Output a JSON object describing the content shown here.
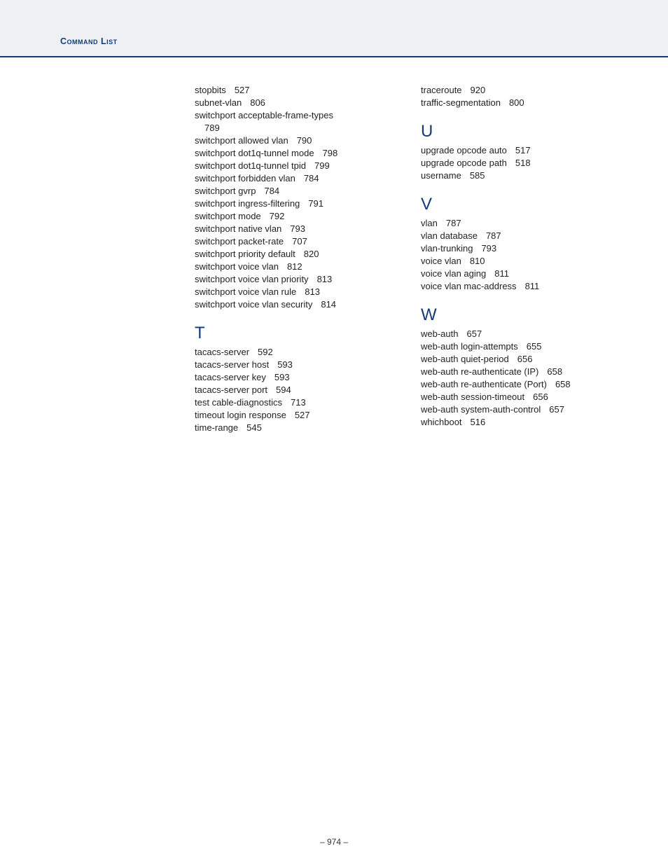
{
  "header": {
    "title": "Command List"
  },
  "footer": {
    "page": "– 974 –"
  },
  "col1_pre_entries": [
    {
      "cmd": "stopbits",
      "pg": "527"
    },
    {
      "cmd": "subnet-vlan",
      "pg": "806"
    },
    {
      "cmd": "switchport acceptable-frame-types",
      "pg": "789",
      "wrap": true
    },
    {
      "cmd": "switchport allowed vlan",
      "pg": "790"
    },
    {
      "cmd": "switchport dot1q-tunnel mode",
      "pg": "798"
    },
    {
      "cmd": "switchport dot1q-tunnel tpid",
      "pg": "799"
    },
    {
      "cmd": "switchport forbidden vlan",
      "pg": "784"
    },
    {
      "cmd": "switchport gvrp",
      "pg": "784"
    },
    {
      "cmd": "switchport ingress-filtering",
      "pg": "791"
    },
    {
      "cmd": "switchport mode",
      "pg": "792"
    },
    {
      "cmd": "switchport native vlan",
      "pg": "793"
    },
    {
      "cmd": "switchport packet-rate",
      "pg": "707"
    },
    {
      "cmd": "switchport priority default",
      "pg": "820"
    },
    {
      "cmd": "switchport voice vlan",
      "pg": "812"
    },
    {
      "cmd": "switchport voice vlan priority",
      "pg": "813"
    },
    {
      "cmd": "switchport voice vlan rule",
      "pg": "813"
    },
    {
      "cmd": "switchport voice vlan security",
      "pg": "814"
    }
  ],
  "col1_sections": [
    {
      "letter": "T",
      "entries": [
        {
          "cmd": "tacacs-server",
          "pg": "592"
        },
        {
          "cmd": "tacacs-server host",
          "pg": "593"
        },
        {
          "cmd": "tacacs-server key",
          "pg": "593"
        },
        {
          "cmd": "tacacs-server port",
          "pg": "594"
        },
        {
          "cmd": "test cable-diagnostics",
          "pg": "713"
        },
        {
          "cmd": "timeout login response",
          "pg": "527"
        },
        {
          "cmd": "time-range",
          "pg": "545"
        }
      ]
    }
  ],
  "col2_pre_entries": [
    {
      "cmd": "traceroute",
      "pg": "920"
    },
    {
      "cmd": "traffic-segmentation",
      "pg": "800"
    }
  ],
  "col2_sections": [
    {
      "letter": "U",
      "entries": [
        {
          "cmd": "upgrade opcode auto",
          "pg": "517"
        },
        {
          "cmd": "upgrade opcode path",
          "pg": "518"
        },
        {
          "cmd": "username",
          "pg": "585"
        }
      ]
    },
    {
      "letter": "V",
      "entries": [
        {
          "cmd": "vlan",
          "pg": "787"
        },
        {
          "cmd": "vlan database",
          "pg": "787"
        },
        {
          "cmd": "vlan-trunking",
          "pg": "793"
        },
        {
          "cmd": "voice vlan",
          "pg": "810"
        },
        {
          "cmd": "voice vlan aging",
          "pg": "811"
        },
        {
          "cmd": "voice vlan mac-address",
          "pg": "811"
        }
      ]
    },
    {
      "letter": "W",
      "entries": [
        {
          "cmd": "web-auth",
          "pg": "657"
        },
        {
          "cmd": "web-auth login-attempts",
          "pg": "655"
        },
        {
          "cmd": "web-auth quiet-period",
          "pg": "656"
        },
        {
          "cmd": "web-auth re-authenticate (IP)",
          "pg": "658"
        },
        {
          "cmd": "web-auth re-authenticate (Port)",
          "pg": "658"
        },
        {
          "cmd": "web-auth session-timeout",
          "pg": "656"
        },
        {
          "cmd": "web-auth system-auth-control",
          "pg": "657"
        },
        {
          "cmd": "whichboot",
          "pg": "516"
        }
      ]
    }
  ]
}
